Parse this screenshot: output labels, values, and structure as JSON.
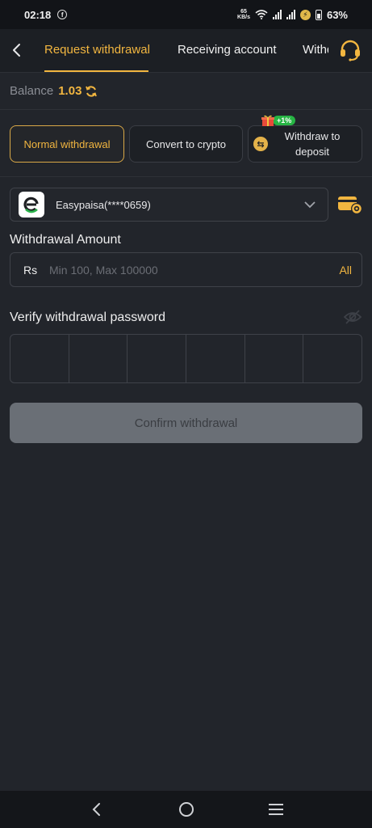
{
  "status_bar": {
    "time": "02:18",
    "facebook_glyph": "f",
    "net_speed_top": "65",
    "net_speed_bottom": "KB/s",
    "battery": "63%"
  },
  "nav": {
    "tabs": [
      {
        "label": "Request withdrawal",
        "active": true
      },
      {
        "label": "Receiving account",
        "active": false
      },
      {
        "label": "Withdrawal record",
        "active": false
      }
    ]
  },
  "balance": {
    "label": "Balance",
    "value": "1.03"
  },
  "methods": {
    "normal": "Normal withdrawal",
    "crypto": "Convert to crypto",
    "deposit": "Withdraw to deposit",
    "deposit_bonus": "+1%"
  },
  "account": {
    "selected": "Easypaisa(****0659)"
  },
  "amount": {
    "label": "Withdrawal Amount",
    "currency": "Rs",
    "placeholder": "Min 100, Max 100000",
    "all_label": "All"
  },
  "password": {
    "label": "Verify withdrawal password",
    "digits": 6
  },
  "confirm": {
    "label": "Confirm withdrawal"
  },
  "colors": {
    "accent": "#f2b640",
    "background": "#22252b",
    "bonus_green": "#27b544"
  }
}
